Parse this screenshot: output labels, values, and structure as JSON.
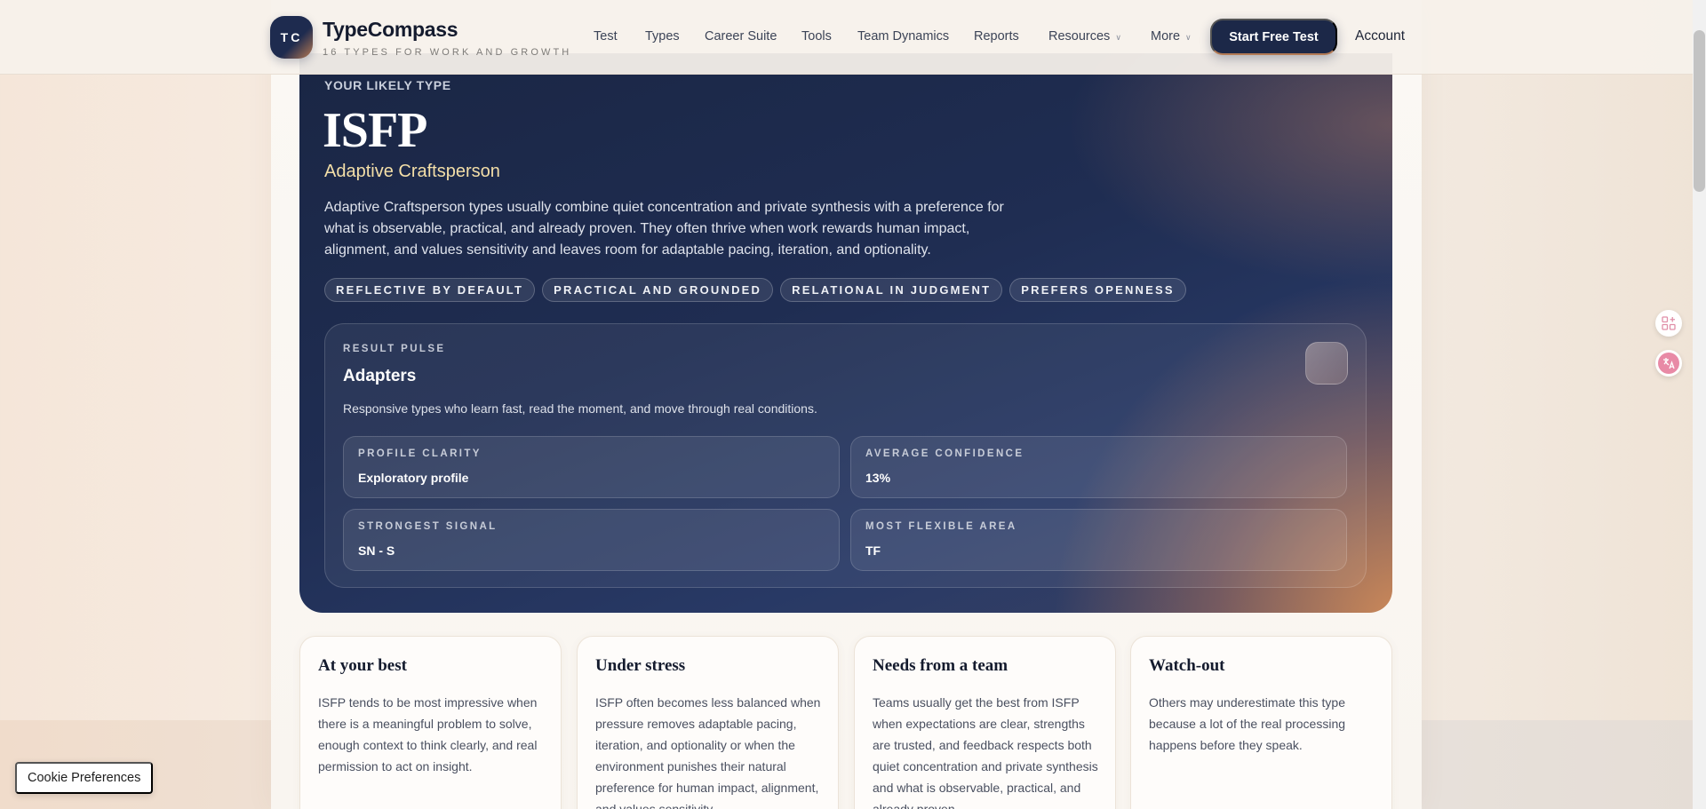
{
  "header": {
    "logo_text": "TC",
    "brand_name": "TypeCompass",
    "tagline": "16 Types for Work and Growth",
    "nav": [
      {
        "label": "Test"
      },
      {
        "label": "Types"
      },
      {
        "label": "Career Suite"
      },
      {
        "label": "Tools"
      },
      {
        "label": "Team Dynamics"
      },
      {
        "label": "Reports"
      },
      {
        "label": "Resources"
      },
      {
        "label": "More"
      }
    ],
    "cta_label": "Start Free Test",
    "account_label": "Account"
  },
  "hero": {
    "eyebrow": "YOUR LIKELY TYPE",
    "type_code": "ISFP",
    "type_name": "Adaptive Craftsperson",
    "description": "Adaptive Craftsperson types usually combine quiet concentration and private synthesis with a preference for what is observable, practical, and already proven. They often thrive when work rewards human impact, alignment, and values sensitivity and leaves room for adaptable pacing, iteration, and optionality.",
    "chips": [
      "REFLECTIVE BY DEFAULT",
      "PRACTICAL AND GROUNDED",
      "RELATIONAL IN JUDGMENT",
      "PREFERS OPENNESS"
    ]
  },
  "pulse": {
    "eyebrow": "RESULT PULSE",
    "title": "Adapters",
    "description": "Responsive types who learn fast, read the moment, and move through real conditions.",
    "stats": [
      {
        "label": "PROFILE CLARITY",
        "value": "Exploratory profile"
      },
      {
        "label": "AVERAGE CONFIDENCE",
        "value": "13%"
      },
      {
        "label": "STRONGEST SIGNAL",
        "value": "SN - S"
      },
      {
        "label": "MOST FLEXIBLE AREA",
        "value": "TF"
      }
    ]
  },
  "cards": [
    {
      "title": "At your best",
      "text": "ISFP tends to be most impressive when there is a meaningful problem to solve, enough context to think clearly, and real permission to act on insight."
    },
    {
      "title": "Under stress",
      "text": "ISFP often becomes less balanced when pressure removes adaptable pacing, iteration, and optionality or when the environment punishes their natural preference for human impact, alignment, and values sensitivity."
    },
    {
      "title": "Needs from a team",
      "text": "Teams usually get the best from ISFP when expectations are clear, strengths are trusted, and feedback respects both quiet concentration and private synthesis and what is observable, practical, and already proven."
    },
    {
      "title": "Watch-out",
      "text": "Others may underestimate this type because a lot of the real processing happens before they speak."
    }
  ],
  "cookie_label": "Cookie Preferences",
  "colors": {
    "navy": "#1c2848",
    "accent_copper": "#c98a5c",
    "type_name_gold": "#f4dfa8"
  }
}
